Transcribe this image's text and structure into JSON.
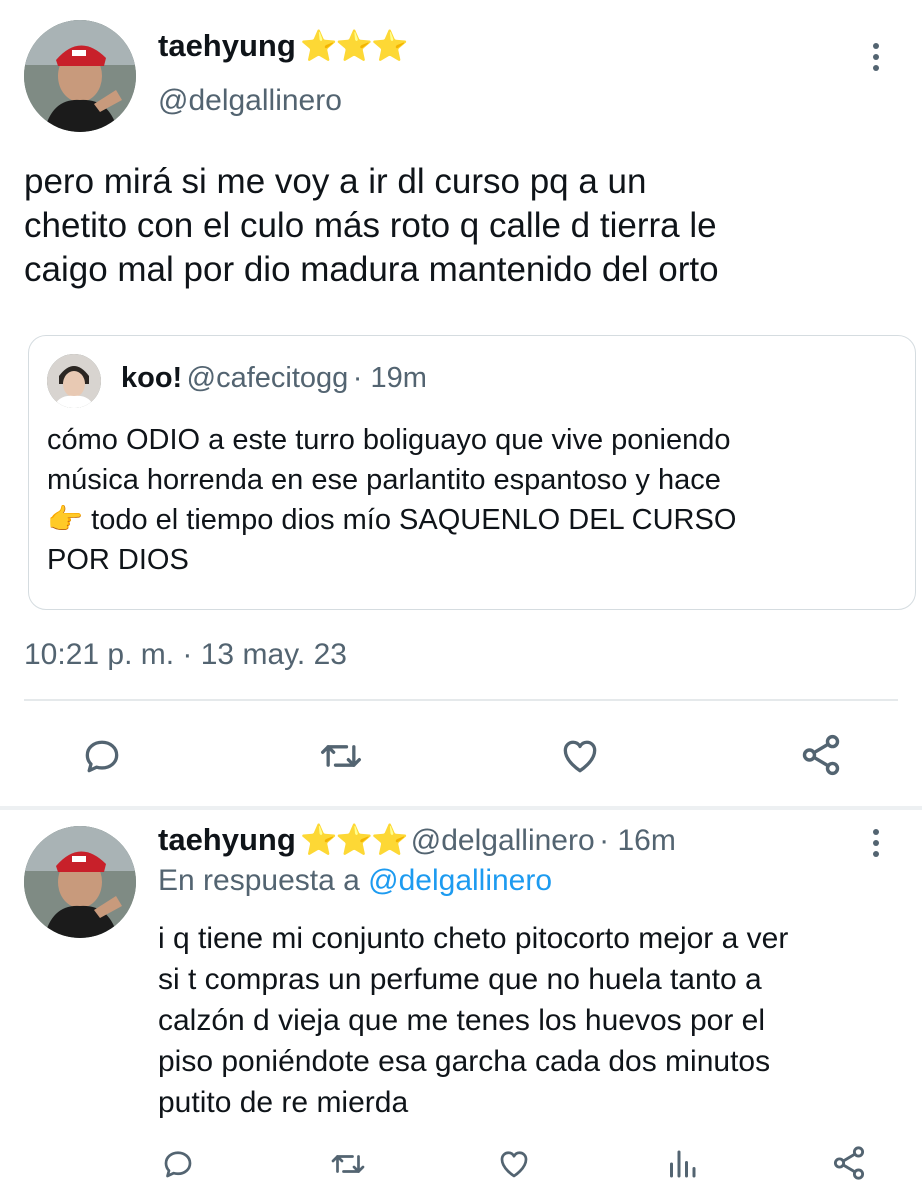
{
  "main_tweet": {
    "author_name": "taehyung",
    "stars": "⭐⭐⭐",
    "handle": "@delgallinero",
    "text_line1": "pero mirá si me voy a ir dl curso pq a un",
    "text_line2": "chetito con el culo más roto q calle d tierra le",
    "text_line3": "caigo mal por dio madura mantenido del orto",
    "timestamp": "10:21 p. m. · 13 may. 23"
  },
  "quoted_tweet": {
    "author_name": "koo!",
    "handle": "@cafecitogg",
    "time_ago": "· 19m",
    "text_line1": "cómo ODIO a este turro boliguayo que vive poniendo",
    "text_line2": "música horrenda en ese parlantito espantoso y hace",
    "text_line3_emoji": "👉",
    "text_line3": " todo el tiempo dios mío SAQUENLO DEL CURSO",
    "text_line4": "POR DIOS"
  },
  "reply_tweet": {
    "author_name": "taehyung",
    "stars": "⭐⭐⭐",
    "handle": "@delgallinero",
    "time_ago": "· 16m",
    "reply_prefix": "En respuesta a",
    "reply_to": "@delgallinero",
    "text_line1": "i q tiene mi conjunto cheto pitocorto mejor a ver",
    "text_line2": "si t compras un perfume que no huela tanto a",
    "text_line3": "calzón d vieja que me tenes los huevos por el",
    "text_line4": "piso poniéndote esa garcha cada dos minutos",
    "text_line5": "putito de re mierda"
  },
  "icons": {
    "reply": "reply-icon",
    "retweet": "retweet-icon",
    "like": "heart-icon",
    "share": "share-icon",
    "analytics": "analytics-icon",
    "menu": "more-vertical-icon"
  },
  "colors": {
    "text": "#0f1419",
    "secondary": "#536471",
    "link": "#1d9bf0",
    "divider": "#e5e9eb"
  }
}
